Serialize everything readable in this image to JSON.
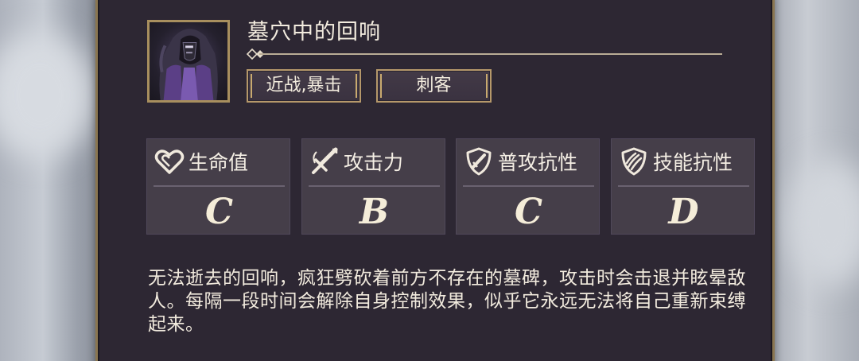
{
  "hero": {
    "name": "墓穴中的回响",
    "tags": [
      "近战,暴击",
      "刺客"
    ]
  },
  "stats": [
    {
      "label": "生命值",
      "grade": "C",
      "icon": "heart-icon"
    },
    {
      "label": "攻击力",
      "grade": "B",
      "icon": "sword-icon"
    },
    {
      "label": "普攻抗性",
      "grade": "C",
      "icon": "shield-icon"
    },
    {
      "label": "技能抗性",
      "grade": "D",
      "icon": "shield-claw-icon"
    }
  ],
  "description": "无法逝去的回响，疯狂劈砍着前方不存在的墓碑，攻击时会击退并眩晕敌人。每隔一段时间会解除自身控制效果，似乎它永远无法将自己重新束缚起来。",
  "colors": {
    "panel": "#2d2733",
    "gold_border": "#8a7650",
    "stat_box": "#453e49",
    "text": "#f2ebde"
  }
}
